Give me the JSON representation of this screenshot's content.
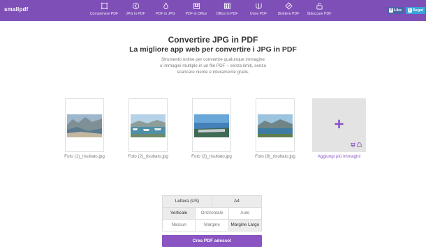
{
  "brand": {
    "logo": "smallpdf"
  },
  "nav": {
    "items": [
      {
        "label": "Comprimere PDF",
        "icon": "compress-icon"
      },
      {
        "label": "JPG in PDF",
        "icon": "jpg-to-pdf-icon"
      },
      {
        "label": "PDF in JPG",
        "icon": "pdf-to-jpg-icon"
      },
      {
        "label": "PDF in Office",
        "icon": "pdf-to-office-icon"
      },
      {
        "label": "Office in PDF",
        "icon": "office-to-pdf-icon"
      },
      {
        "label": "Unire PDF",
        "icon": "merge-icon"
      },
      {
        "label": "Dividere PDF",
        "icon": "split-icon"
      },
      {
        "label": "Sbloccare PDF",
        "icon": "unlock-icon"
      }
    ]
  },
  "social": {
    "facebook": "Like",
    "twitter": "Segui"
  },
  "hero": {
    "title": "Convertire JPG in PDF",
    "subtitle": "La migliore app web per convertire i JPG in PDF",
    "desc_line1": "Strumento online per convertire qualunque immagine",
    "desc_line2": "o immagini multiple in un file PDF – senza limiti, senza",
    "desc_line3": "scaricare niente e interamente gratis."
  },
  "files": [
    {
      "name": "Foto (1)_risultato.jpg"
    },
    {
      "name": "Foto (2)_risultato.jpg"
    },
    {
      "name": "Foto (3)_risultato.jpg"
    },
    {
      "name": "Foto (8)_risultato.jpg"
    }
  ],
  "add": {
    "symbol": "+",
    "label": "Aggiungi più immagini"
  },
  "options": {
    "page_size": [
      "Lettera (US)",
      "A4"
    ],
    "orientation": [
      "Verticale",
      "Orizzontale",
      "Auto"
    ],
    "margin": [
      "Nessun",
      "Margine",
      "Margine Largo"
    ],
    "selected": {
      "orientation": "Verticale",
      "margin": "Margine Largo"
    }
  },
  "cta": {
    "label": "Crea PDF adesso!"
  },
  "colors": {
    "brand": "#7f4fb8",
    "accent": "#8a54c2",
    "add_card": "#e3e3e3"
  }
}
